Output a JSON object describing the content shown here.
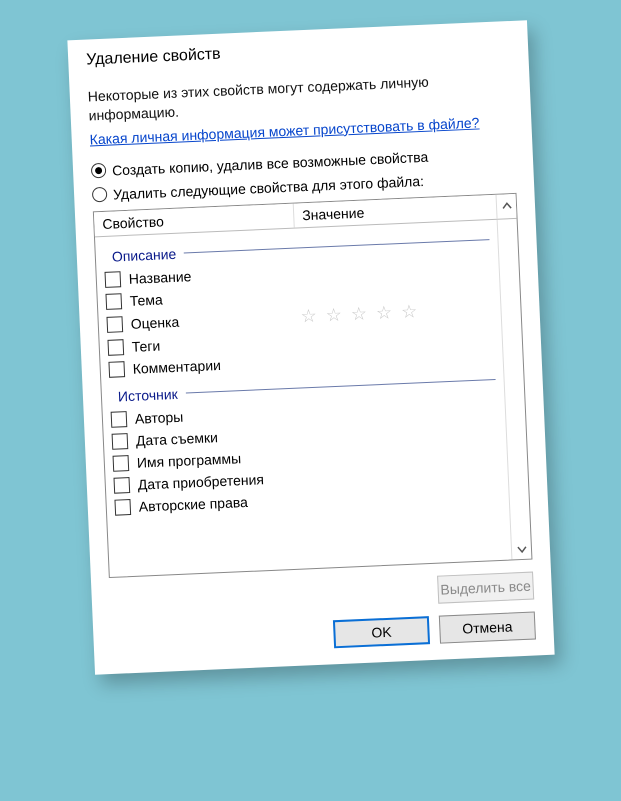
{
  "title": "Удаление свойств",
  "intro": "Некоторые из этих свойств могут содержать личную информацию.",
  "link": "Какая личная информация может присутствовать в файле?",
  "radio1": "Создать копию, удалив все возможные свойства",
  "radio2": "Удалить следующие свойства для этого файла:",
  "columns": {
    "name": "Свойство",
    "value": "Значение"
  },
  "groups": [
    {
      "title": "Описание",
      "items": [
        {
          "label": "Название"
        },
        {
          "label": "Тема"
        },
        {
          "label": "Оценка",
          "stars": "☆ ☆ ☆ ☆ ☆"
        },
        {
          "label": "Теги"
        },
        {
          "label": "Комментарии"
        }
      ]
    },
    {
      "title": "Источник",
      "items": [
        {
          "label": "Авторы"
        },
        {
          "label": "Дата съемки"
        },
        {
          "label": "Имя программы"
        },
        {
          "label": "Дата приобретения"
        },
        {
          "label": "Авторские права"
        }
      ]
    }
  ],
  "buttons": {
    "select_all": "Выделить все",
    "ok": "OK",
    "cancel": "Отмена"
  }
}
